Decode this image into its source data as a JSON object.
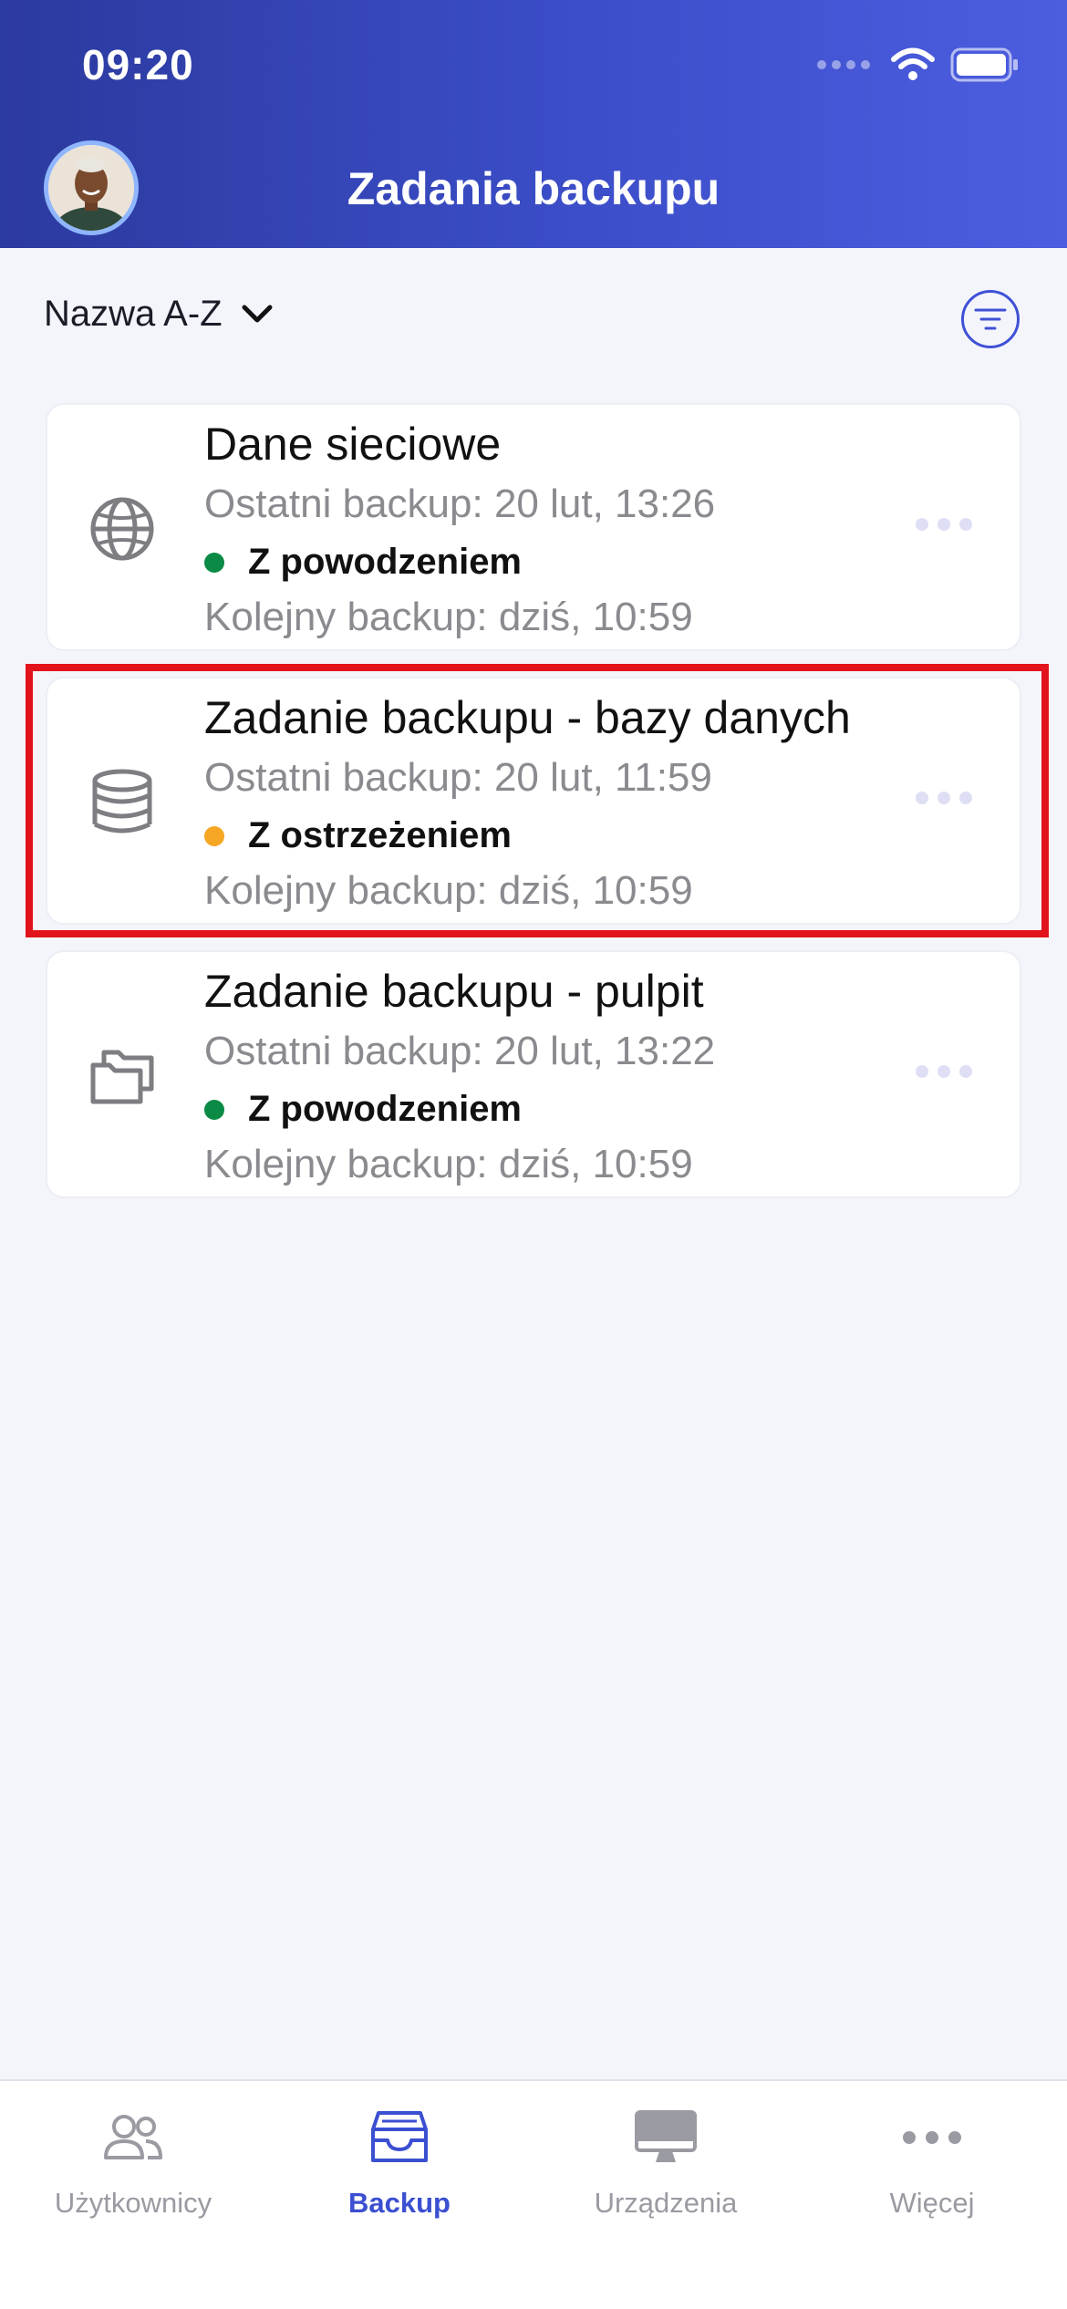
{
  "status_bar": {
    "time": "09:20"
  },
  "header": {
    "title": "Zadania backupu"
  },
  "sort": {
    "label": "Nazwa A-Z"
  },
  "jobs": [
    {
      "icon": "globe-icon",
      "title": "Dane sieciowe",
      "last_backup": "Ostatni backup: 20 lut, 13:26",
      "status": "Z powodzeniem",
      "status_color": "#0a8a44",
      "next_backup": "Kolejny backup: dziś, 10:59"
    },
    {
      "icon": "database-icon",
      "title": "Zadanie backupu - bazy danych",
      "last_backup": "Ostatni backup: 20 lut, 11:59",
      "status": "Z ostrzeżeniem",
      "status_color": "#f5a623",
      "next_backup": "Kolejny backup: dziś, 10:59"
    },
    {
      "icon": "folders-icon",
      "title": "Zadanie backupu - pulpit",
      "last_backup": "Ostatni backup: 20 lut, 13:22",
      "status": "Z powodzeniem",
      "status_color": "#0a8a44",
      "next_backup": "Kolejny backup: dziś, 10:59"
    }
  ],
  "bottom_nav": {
    "items": [
      {
        "label": "Użytkownicy",
        "icon": "users-icon",
        "active": false
      },
      {
        "label": "Backup",
        "icon": "backup-box-icon",
        "active": true
      },
      {
        "label": "Urządzenia",
        "icon": "monitor-icon",
        "active": false
      },
      {
        "label": "Więcej",
        "icon": "more-dots-icon",
        "active": false
      }
    ]
  },
  "colors": {
    "accent": "#3b4fd1",
    "header_gradient_start": "#2b3a9e",
    "header_gradient_end": "#4c5de0",
    "highlight": "#e3131b"
  }
}
